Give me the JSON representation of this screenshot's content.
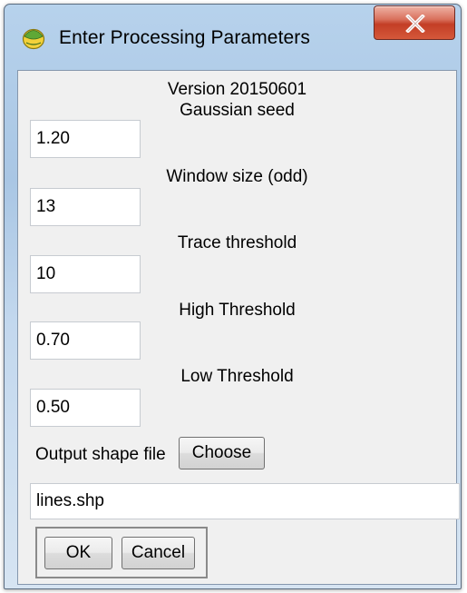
{
  "window": {
    "title": "Enter Processing Parameters"
  },
  "form": {
    "version": "Version 20150601",
    "fields": [
      {
        "label": "Gaussian seed",
        "value": "1.20"
      },
      {
        "label": "Window size (odd)",
        "value": "13"
      },
      {
        "label": "Trace threshold",
        "value": "10"
      },
      {
        "label": "High Threshold",
        "value": "0.70"
      },
      {
        "label": "Low Threshold",
        "value": "0.50"
      }
    ],
    "output": {
      "label": "Output shape file",
      "choose_label": "Choose",
      "value": "lines.shp"
    }
  },
  "buttons": {
    "ok_label": "OK",
    "cancel_label": "Cancel"
  },
  "icons": {
    "app": "qgis-icon",
    "close": "close-icon"
  },
  "colors": {
    "close_button": "#c7432b",
    "frame": "#b7d2ec"
  }
}
